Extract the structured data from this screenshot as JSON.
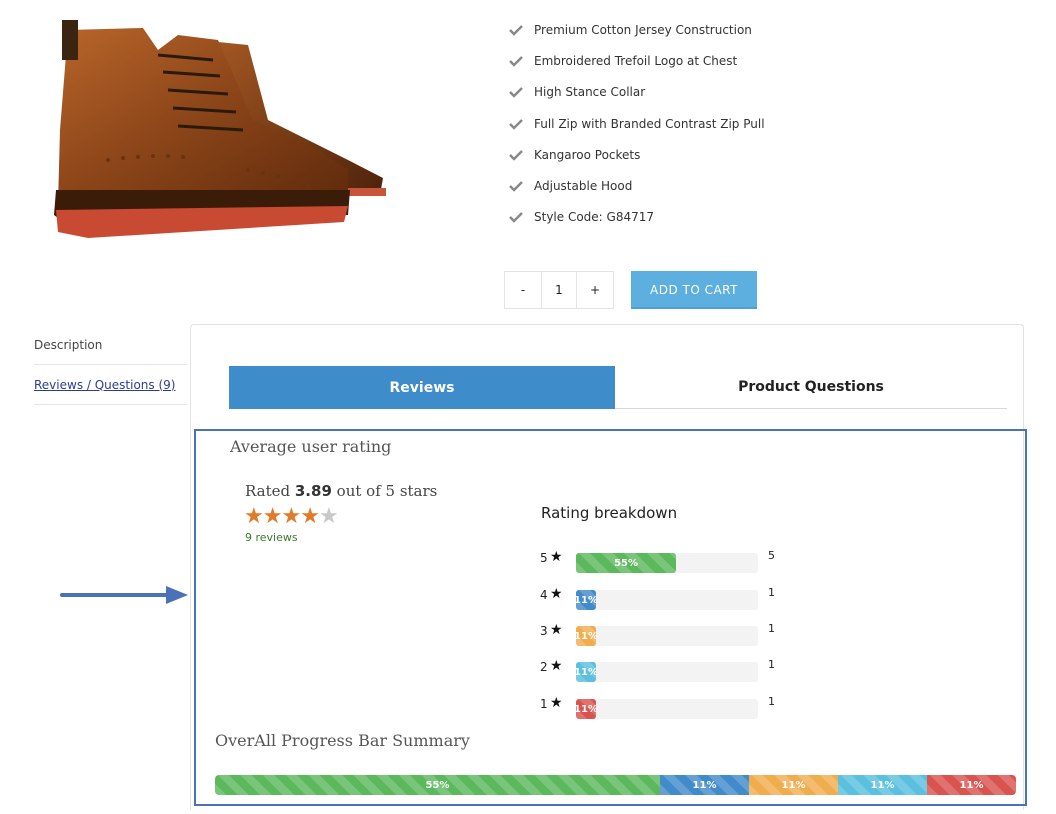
{
  "features": [
    "Premium Cotton Jersey Construction",
    "Embroidered Trefoil Logo at Chest",
    "High Stance Collar",
    "Full Zip with Branded Contrast Zip Pull",
    "Kangaroo Pockets",
    "Adjustable Hood",
    "Style Code: G84717"
  ],
  "cart": {
    "minus_label": "-",
    "quantity": "1",
    "plus_label": "+",
    "add_to_cart_label": "ADD TO CART"
  },
  "side_tabs": {
    "description": "Description",
    "reviews": "Reviews / Questions (9)"
  },
  "tabs": {
    "reviews": "Reviews",
    "questions": "Product Questions"
  },
  "rating": {
    "section_title": "Average user rating",
    "rated_prefix": "Rated",
    "value": "3.89",
    "rated_suffix": "out of 5 stars",
    "stars_filled": 4,
    "stars_total": 5,
    "review_count": "9 reviews"
  },
  "breakdown": {
    "title": "Rating breakdown",
    "rows": [
      {
        "stars": "5",
        "percent": 55,
        "percent_label": "55%",
        "count": "5",
        "color": "#5cb85c"
      },
      {
        "stars": "4",
        "percent": 11,
        "percent_label": "11%",
        "count": "1",
        "color": "#428bca"
      },
      {
        "stars": "3",
        "percent": 11,
        "percent_label": "11%",
        "count": "1",
        "color": "#f0ad4e"
      },
      {
        "stars": "2",
        "percent": 11,
        "percent_label": "11%",
        "count": "1",
        "color": "#5bc0de"
      },
      {
        "stars": "1",
        "percent": 11,
        "percent_label": "11%",
        "count": "1",
        "color": "#d9534f"
      }
    ]
  },
  "summary": {
    "title": "OverAll Progress Bar Summary",
    "segments": [
      {
        "percent": 55,
        "label": "55%",
        "color": "#5cb85c"
      },
      {
        "percent": 11,
        "label": "11%",
        "color": "#428bca"
      },
      {
        "percent": 11,
        "label": "11%",
        "color": "#f0ad4e"
      },
      {
        "percent": 11,
        "label": "11%",
        "color": "#5bc0de"
      },
      {
        "percent": 11,
        "label": "11%",
        "color": "#d9534f"
      }
    ]
  },
  "colors": {
    "accent": "#3f8ccb",
    "highlight_border": "#4a72b8"
  }
}
